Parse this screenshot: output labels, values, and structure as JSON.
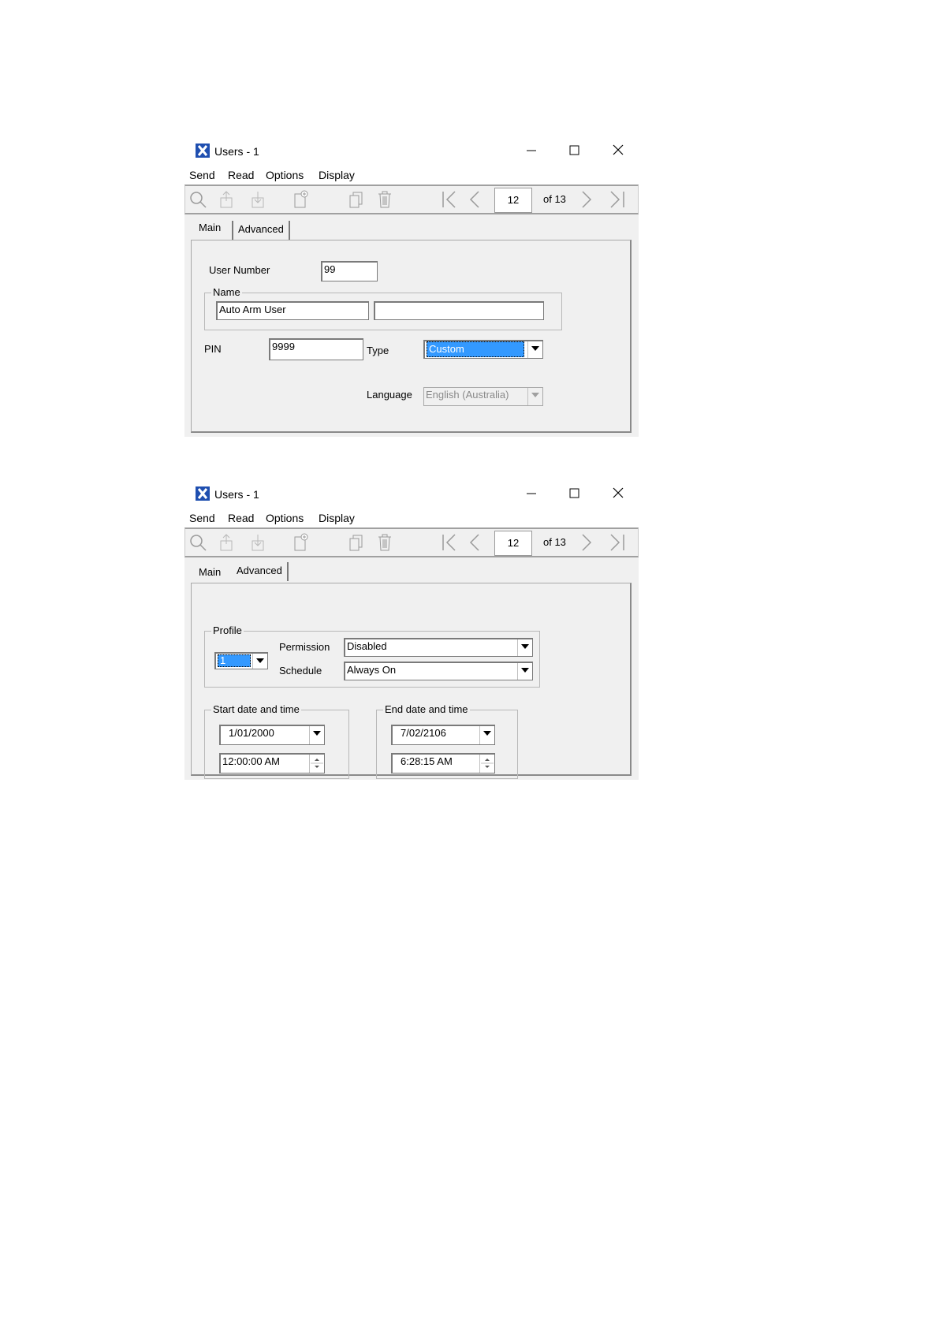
{
  "window1": {
    "title": "Users - 1",
    "menu": [
      "Send",
      "Read",
      "Options",
      "Display"
    ],
    "toolbar": {
      "record_number": "12",
      "record_of": "of 13"
    },
    "tabs": {
      "main": "Main",
      "advanced": "Advanced",
      "active": "Main"
    },
    "main": {
      "user_number_label": "User Number",
      "user_number_value": "99",
      "name_group_label": "Name",
      "name_first": "Auto Arm User",
      "name_second": "",
      "pin_label": "PIN",
      "pin_value": "9999",
      "type_label": "Type",
      "type_value": "Custom",
      "language_label": "Language",
      "language_value": "English (Australia)"
    }
  },
  "window2": {
    "title": "Users - 1",
    "menu": [
      "Send",
      "Read",
      "Options",
      "Display"
    ],
    "toolbar": {
      "record_number": "12",
      "record_of": "of 13"
    },
    "tabs": {
      "main": "Main",
      "advanced": "Advanced",
      "active": "Advanced"
    },
    "advanced": {
      "profile_group_label": "Profile",
      "profile_value": "1",
      "permission_label": "Permission",
      "permission_value": "Disabled",
      "schedule_label": "Schedule",
      "schedule_value": "Always On",
      "start_group_label": "Start date and time",
      "start_date": "1/01/2000",
      "start_time": "12:00:00 AM",
      "end_group_label": "End date and time",
      "end_date": "7/02/2106",
      "end_time": "6:28:15 AM"
    }
  },
  "icons": [
    "app-x-icon",
    "minimize-icon",
    "maximize-icon",
    "close-icon",
    "search-icon",
    "upload-icon",
    "download-icon",
    "new-record-icon",
    "copy-icon",
    "delete-icon",
    "first-record-icon",
    "previous-record-icon",
    "next-record-icon",
    "last-record-icon",
    "dropdown-arrow-icon",
    "spinner-icon"
  ],
  "colors": {
    "selection": "#3399ff",
    "app_icon": "#1f4fb0",
    "window_bg": "#f0f0f0"
  }
}
